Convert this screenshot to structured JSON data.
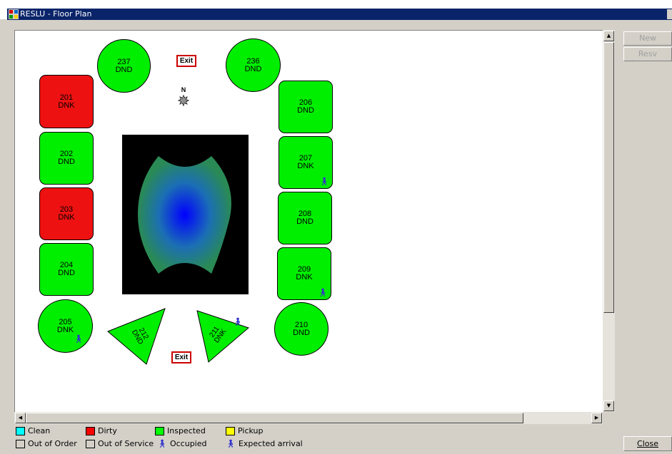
{
  "window": {
    "title": "RESLU - Floor Plan"
  },
  "side_buttons": {
    "new": "New",
    "resv": "Resv",
    "close": "Close"
  },
  "compass": {
    "north": "N"
  },
  "exits": {
    "top": "Exit",
    "bottom": "Exit"
  },
  "rooms": [
    {
      "number": "237",
      "status": "DND",
      "color": "#00ee00"
    },
    {
      "number": "236",
      "status": "DND",
      "color": "#00ee00"
    },
    {
      "number": "201",
      "status": "DNK",
      "color": "#ee1111"
    },
    {
      "number": "202",
      "status": "DND",
      "color": "#00ee00"
    },
    {
      "number": "203",
      "status": "DNK",
      "color": "#ee1111"
    },
    {
      "number": "204",
      "status": "DND",
      "color": "#00ee00"
    },
    {
      "number": "205",
      "status": "DNK",
      "color": "#00ee00",
      "occupied": true
    },
    {
      "number": "206",
      "status": "DND",
      "color": "#00ee00"
    },
    {
      "number": "207",
      "status": "DNK",
      "color": "#00ee00",
      "occupied": true
    },
    {
      "number": "208",
      "status": "DND",
      "color": "#00ee00"
    },
    {
      "number": "209",
      "status": "DNK",
      "color": "#00ee00",
      "occupied": true
    },
    {
      "number": "210",
      "status": "DND",
      "color": "#00ee00"
    },
    {
      "number": "212",
      "status": "DND",
      "color": "#00ee00"
    },
    {
      "number": "211",
      "status": "DNK",
      "color": "#00ee00",
      "occupied": true
    }
  ],
  "legend": {
    "clean": {
      "label": "Clean",
      "color": "#00ffff"
    },
    "dirty": {
      "label": "Dirty",
      "color": "#ff0000"
    },
    "inspected": {
      "label": "Inspected",
      "color": "#00ff00"
    },
    "pickup": {
      "label": "Pickup",
      "color": "#ffff00"
    },
    "out_of_order": {
      "label": "Out of Order",
      "color": "#d4d0c8"
    },
    "out_of_service": {
      "label": "Out of Service",
      "color": "#d4d0c8"
    },
    "occupied": {
      "label": "Occupied",
      "icon": "person-icon"
    },
    "expected_arrival": {
      "label": "Expected arrival",
      "icon": "person-arrival-icon"
    }
  }
}
